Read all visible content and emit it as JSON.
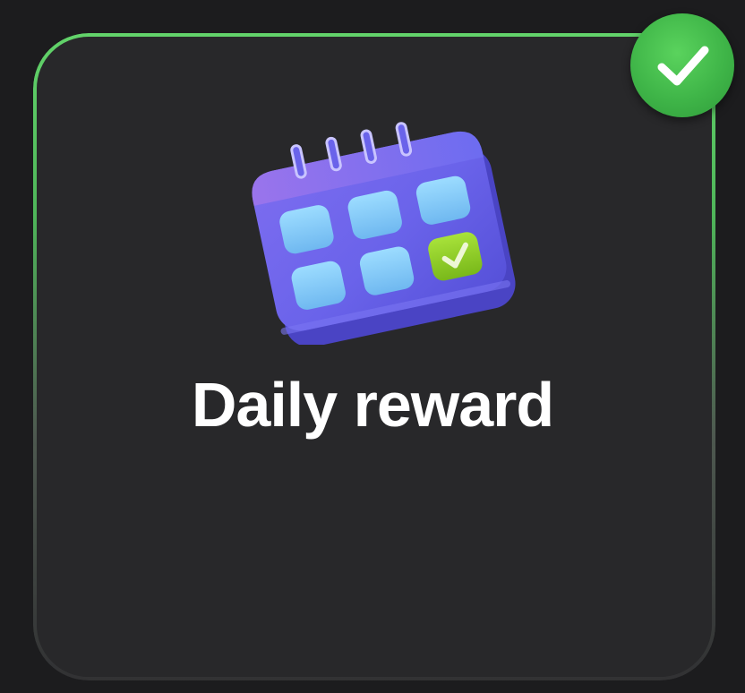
{
  "card": {
    "title": "Daily reward",
    "completed": true
  },
  "icons": {
    "calendar": "calendar-icon",
    "badge": "check-badge-icon"
  },
  "colors": {
    "background": "#1c1c1e",
    "card_fill": "#28282a",
    "border_green": "#62d36a",
    "badge_green": "#3fb548",
    "calendar_body": "#6a63ea",
    "calendar_cell": "#7cc6f4",
    "check_cell": "#8fcc1f"
  }
}
